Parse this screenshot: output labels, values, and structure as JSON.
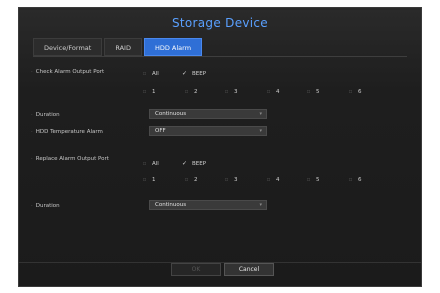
{
  "window": {
    "title": "Storage Device"
  },
  "tabs": [
    {
      "label": "Device/Format"
    },
    {
      "label": "RAID"
    },
    {
      "label": "HDD Alarm"
    }
  ],
  "check_alarm": {
    "label": "Check Alarm Output Port",
    "all_label": "All",
    "beep_label": "BEEP",
    "ports": [
      "1",
      "2",
      "3",
      "4",
      "5",
      "6"
    ]
  },
  "duration1": {
    "label": "Duration",
    "value": "Continuous"
  },
  "hdd_temp": {
    "label": "HDD Temperature Alarm",
    "value": "OFF"
  },
  "replace_alarm": {
    "label": "Replace Alarm Output Port",
    "all_label": "All",
    "beep_label": "BEEP",
    "ports": [
      "1",
      "2",
      "3",
      "4",
      "5",
      "6"
    ]
  },
  "duration2": {
    "label": "Duration",
    "value": "Continuous"
  },
  "footer": {
    "ok_label": "OK",
    "cancel_label": "Cancel"
  }
}
